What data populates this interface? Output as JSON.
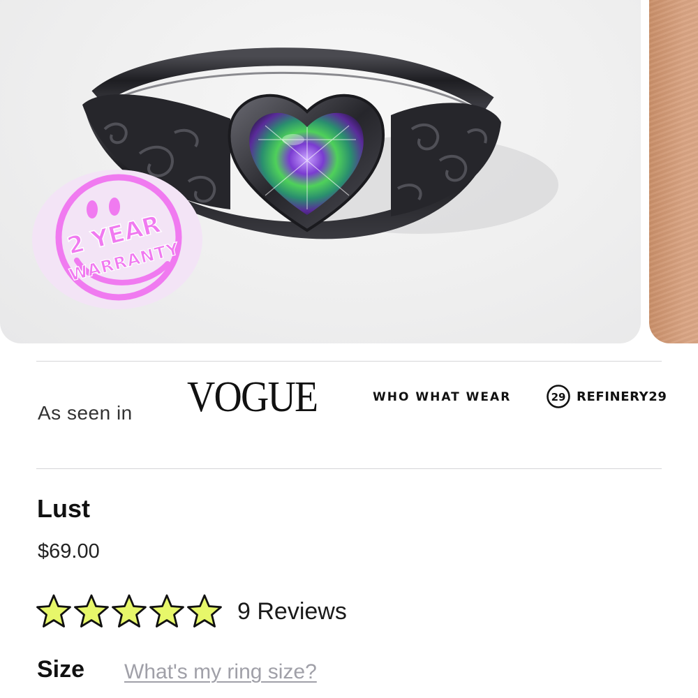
{
  "gallery": {
    "main_image_subject": "black heart ring with mystic topaz stone",
    "sticker": {
      "line1": "2 YEAR",
      "line2": "WARRANTY",
      "color": "#f07af0"
    }
  },
  "press": {
    "label": "As seen in",
    "logos": [
      {
        "name": "VOGUE",
        "icon": "vogue-logo"
      },
      {
        "name": "WHO WHAT WEAR",
        "icon": "who-what-wear-logo"
      },
      {
        "name": "REFINERY29",
        "icon": "refinery29-logo",
        "badge": "29"
      }
    ]
  },
  "product": {
    "name": "Lust",
    "price": "$69.00",
    "rating": {
      "stars": 5,
      "max_stars": 5,
      "reviews_label": "9 Reviews",
      "star_color": "#e7f76a"
    },
    "size": {
      "label": "Size",
      "help_link": "What's my ring size?"
    }
  }
}
